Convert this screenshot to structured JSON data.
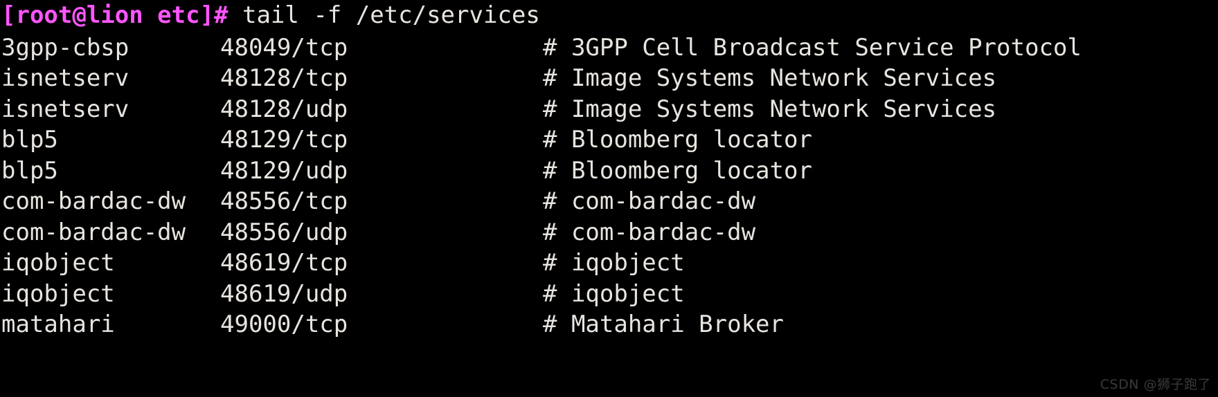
{
  "terminal": {
    "background_color": "#000000",
    "foreground_color": "#e8e4df",
    "prompt_color": "#ff55ff",
    "prompt": "[root@lion etc]#",
    "command": " tail -f /etc/services",
    "columns": [
      "service",
      "port",
      "comment"
    ],
    "rows": [
      {
        "service": "3gpp-cbsp",
        "port": "48049/tcp",
        "comment": "# 3GPP Cell Broadcast Service Protocol"
      },
      {
        "service": "isnetserv",
        "port": "48128/tcp",
        "comment": "# Image Systems Network Services"
      },
      {
        "service": "isnetserv",
        "port": "48128/udp",
        "comment": "# Image Systems Network Services"
      },
      {
        "service": "blp5",
        "port": "48129/tcp",
        "comment": "# Bloomberg locator"
      },
      {
        "service": "blp5",
        "port": "48129/udp",
        "comment": "# Bloomberg locator"
      },
      {
        "service": "com-bardac-dw",
        "port": "48556/tcp",
        "comment": "# com-bardac-dw"
      },
      {
        "service": "com-bardac-dw",
        "port": "48556/udp",
        "comment": "# com-bardac-dw"
      },
      {
        "service": "iqobject",
        "port": "48619/tcp",
        "comment": "# iqobject"
      },
      {
        "service": "iqobject",
        "port": "48619/udp",
        "comment": "# iqobject"
      },
      {
        "service": "matahari",
        "port": "49000/tcp",
        "comment": "# Matahari Broker"
      }
    ]
  },
  "watermark": {
    "text": "CSDN @狮子跑了",
    "color": "#3a3a3a"
  }
}
